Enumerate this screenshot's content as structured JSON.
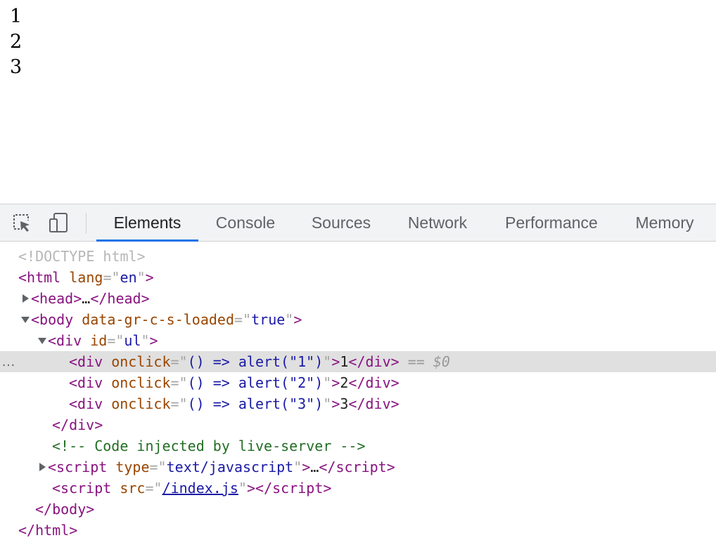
{
  "page": {
    "items": [
      "1",
      "2",
      "3"
    ]
  },
  "devtools": {
    "tabs": [
      "Elements",
      "Console",
      "Sources",
      "Network",
      "Performance",
      "Memory"
    ],
    "active_tab": "Elements",
    "icons": {
      "inspect": "select-element-icon",
      "device": "device-toolbar-icon"
    },
    "accent_color": "#1a73e8",
    "selected_marker": "== $0",
    "row_menu": "…",
    "dom": {
      "doctype": "<!DOCTYPE html>",
      "html_tag": "html",
      "html_attr": "lang",
      "html_lang": "en",
      "head_tag": "head",
      "body_tag": "body",
      "body_attr": "data-gr-c-s-loaded",
      "body_attr_value": "true",
      "div_tag": "div",
      "div_attr": "id",
      "div_id": "ul",
      "children": [
        {
          "attr": "onclick",
          "handler": "() => alert(\"1\")",
          "text": "1"
        },
        {
          "attr": "onclick",
          "handler": "() => alert(\"2\")",
          "text": "2"
        },
        {
          "attr": "onclick",
          "handler": "() => alert(\"3\")",
          "text": "3"
        }
      ],
      "comment": "<!-- Code injected by live-server -->",
      "script_tag": "script",
      "script1_attr": "type",
      "script1_type": "text/javascript",
      "script2_attr": "src",
      "script2_src": "/index.js",
      "collapsed": "…"
    }
  }
}
